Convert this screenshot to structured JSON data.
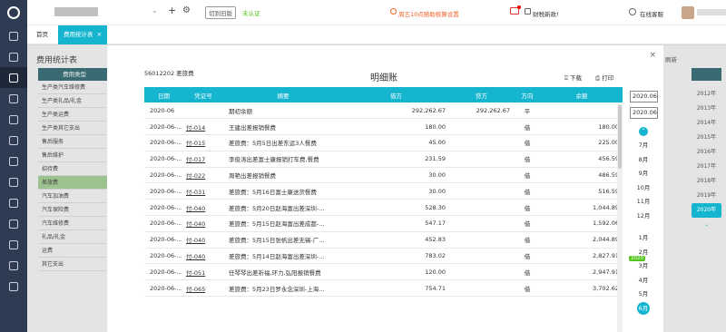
{
  "topbar": {
    "switch_label": "切到旧版",
    "auth_status": "未认证",
    "promo": "周五10点随助核算设置",
    "news": "财税新政!",
    "support": "在线客服"
  },
  "tabs": [
    {
      "label": "首页"
    },
    {
      "label": "费用统计表",
      "close": "×"
    }
  ],
  "background": {
    "title": "费用统计表",
    "list_header": "费用类型",
    "list_items": [
      "生产类汽车维修费",
      "生产类礼品/礼金",
      "生产类运费",
      "生产类其它支出",
      "售后服务",
      "售后维护",
      "招待费",
      "差旅费",
      "汽车加油费",
      "汽车保险费",
      "汽车维修费",
      "礼品/礼金",
      "运费",
      "其它支出"
    ],
    "right_button": "刷新",
    "years": [
      "2012年",
      "2013年",
      "2014年",
      "2015年",
      "2016年",
      "2017年",
      "2018年",
      "2019年",
      "2020年"
    ]
  },
  "modal": {
    "close": "×",
    "account": "56012202 差旅费",
    "title": "明细账",
    "download": "下载",
    "print": "打印",
    "columns": [
      "日期",
      "凭证号",
      "摘要",
      "借方",
      "贷方",
      "方向",
      "余额"
    ],
    "rows": [
      [
        "2020-06",
        "",
        "期初余额",
        "292,262.67",
        "292,262.67",
        "平",
        ""
      ],
      [
        "2020-06-...",
        "付-014",
        "王建出差报销餐费",
        "180.00",
        "",
        "借",
        "180.00"
      ],
      [
        "2020-06-...",
        "付-015",
        "差旅费：5月5日出差东运3人餐费",
        "45.00",
        "",
        "借",
        "225.00"
      ],
      [
        "2020-06-...",
        "付-017",
        "李俊涛出差富士康报销打车费,餐费",
        "231.59",
        "",
        "借",
        "456.59"
      ],
      [
        "2020-06-...",
        "付-022",
        "周艳出差报销餐费",
        "30.00",
        "",
        "借",
        "486.59"
      ],
      [
        "2020-06-...",
        "付-031",
        "差旅费：5月16日富士康送货餐费",
        "30.00",
        "",
        "借",
        "516.59"
      ],
      [
        "2020-06-...",
        "付-040",
        "差旅费：5月20日赵海富出差深圳-...",
        "528.30",
        "",
        "借",
        "1,044.89"
      ],
      [
        "2020-06-...",
        "付-040",
        "差旅费：5月15日赵海富出差成都-...",
        "547.17",
        "",
        "借",
        "1,592.06"
      ],
      [
        "2020-06-...",
        "付-040",
        "差旅费：5月15日张帆出差无锡-广...",
        "452.83",
        "",
        "借",
        "2,044.89"
      ],
      [
        "2020-06-...",
        "付-040",
        "差旅费：5月14日赵海富出差深圳-...",
        "783.02",
        "",
        "借",
        "2,827.91"
      ],
      [
        "2020-06-...",
        "付-051",
        "任琴琴出差祈福,环力,弘阳报销餐费",
        "120.00",
        "",
        "借",
        "2,947.91"
      ],
      [
        "2020-06-...",
        "付-065",
        "差旅费：5月23日罗永念深圳-上海...",
        "754.71",
        "",
        "借",
        "3,702.62"
      ]
    ],
    "date_from": "2020.06",
    "date_to": "2020.06",
    "months_upper": [
      "7月",
      "8月",
      "9月",
      "10月",
      "11月",
      "12月"
    ],
    "year_badge": "2020",
    "months_lower": [
      "1月",
      "2月",
      "3月",
      "4月",
      "5月",
      "6月"
    ]
  }
}
